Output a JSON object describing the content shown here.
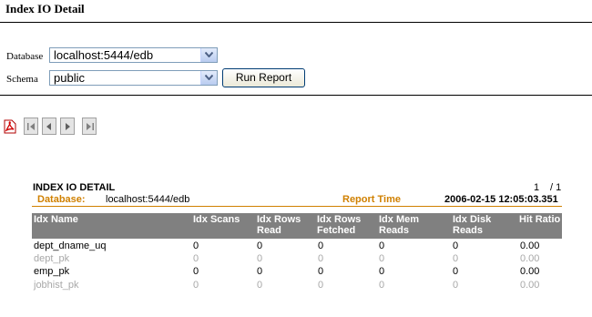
{
  "page": {
    "title": "Index IO Detail"
  },
  "form": {
    "database_label": "Database",
    "database_value": "localhost:5444/edb",
    "schema_label": "Schema",
    "schema_value": "public",
    "run_button": "Run Report"
  },
  "toolbar": {
    "icons": [
      "pdf-export-icon",
      "first-page-icon",
      "previous-page-icon",
      "next-page-icon",
      "last-page-icon"
    ]
  },
  "report": {
    "heading": "INDEX IO DETAIL",
    "page_current": "1",
    "page_total": "/ 1",
    "database_label": "Database:",
    "database_value": "localhost:5444/edb",
    "report_time_label": "Report Time",
    "report_time_value": "2006-02-15 12:05:03.351",
    "columns": [
      "Idx Name",
      "Idx Scans",
      "Idx Rows Read",
      "Idx Rows Fetched",
      "Idx Mem Reads",
      "Idx Disk Reads",
      "Hit Ratio"
    ],
    "rows": [
      {
        "name": "dept_dname_uq",
        "scans": "0",
        "rows_read": "0",
        "rows_fetched": "0",
        "mem_reads": "0",
        "disk_reads": "0",
        "hit_ratio": "0.00"
      },
      {
        "name": "dept_pk",
        "scans": "0",
        "rows_read": "0",
        "rows_fetched": "0",
        "mem_reads": "0",
        "disk_reads": "0",
        "hit_ratio": "0.00"
      },
      {
        "name": "emp_pk",
        "scans": "0",
        "rows_read": "0",
        "rows_fetched": "0",
        "mem_reads": "0",
        "disk_reads": "0",
        "hit_ratio": "0.00"
      },
      {
        "name": "jobhist_pk",
        "scans": "0",
        "rows_read": "0",
        "rows_fetched": "0",
        "mem_reads": "0",
        "disk_reads": "0",
        "hit_ratio": "0.00"
      }
    ]
  },
  "colors": {
    "accent": "#d08000",
    "header_bg": "#808080",
    "dim_text": "#a8a8a8"
  }
}
